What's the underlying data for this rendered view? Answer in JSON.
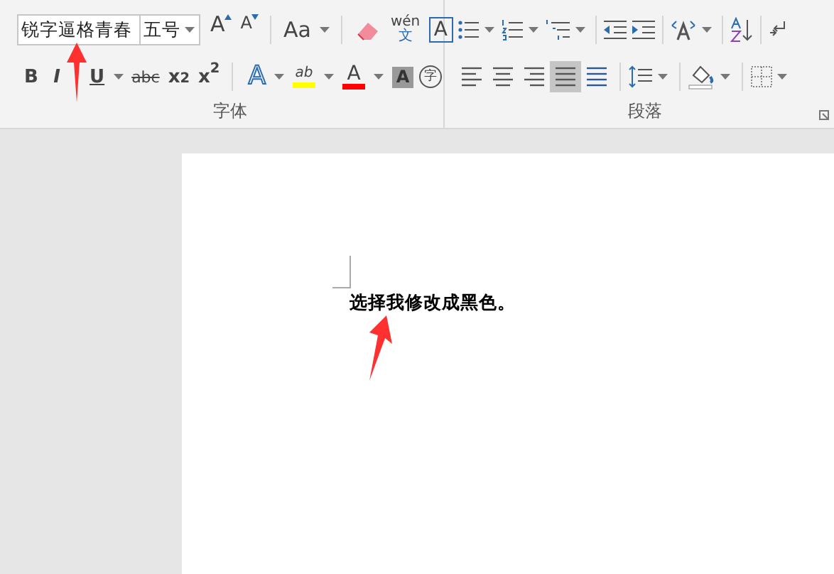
{
  "font_group": {
    "label": "字体",
    "font_name": {
      "value": "锐字逼格青春"
    },
    "font_size": {
      "value": "五号"
    },
    "row1": [
      {
        "kind": "grow",
        "label": "A"
      },
      {
        "kind": "shrink",
        "label": "A"
      },
      {
        "kind": "case",
        "label": "Aa"
      },
      {
        "kind": "clear"
      },
      {
        "kind": "phonetic",
        "label": "wén",
        "sub": "文"
      },
      {
        "kind": "border",
        "label": "A"
      }
    ],
    "row2": [
      {
        "kind": "bold",
        "label": "B"
      },
      {
        "kind": "italic",
        "label": "I"
      },
      {
        "kind": "underline",
        "label": "U"
      },
      {
        "kind": "strike",
        "label": "abc"
      },
      {
        "kind": "subscript",
        "label": "x$_{2}$"
      },
      {
        "kind": "superscript",
        "label": "x$^{2}$"
      },
      {
        "kind": "effects",
        "label": "A"
      },
      {
        "kind": "highlight",
        "label": "ab",
        "color": "#ffff00"
      },
      {
        "kind": "fontcolor",
        "label": "A",
        "color": "#ff0000"
      },
      {
        "kind": "shading",
        "label": "A"
      },
      {
        "kind": "enclose",
        "label": "字"
      }
    ]
  },
  "paragraph_group": {
    "label": "段落",
    "row1": [
      {
        "kind": "bullets"
      },
      {
        "kind": "numbering"
      },
      {
        "kind": "multilevel"
      },
      {
        "kind": "outdent"
      },
      {
        "kind": "indent"
      },
      {
        "kind": "direction"
      },
      {
        "kind": "sort"
      },
      {
        "kind": "marks"
      }
    ],
    "alignments": [
      {
        "kind": "left",
        "selected": false
      },
      {
        "kind": "center",
        "selected": false
      },
      {
        "kind": "right",
        "selected": false
      },
      {
        "kind": "justify",
        "selected": true
      },
      {
        "kind": "distributed",
        "selected": false
      }
    ],
    "row2": [
      {
        "kind": "spacing"
      },
      {
        "kind": "fill"
      },
      {
        "kind": "borders"
      }
    ]
  },
  "document": {
    "text": "选择我修改成黑色。"
  }
}
